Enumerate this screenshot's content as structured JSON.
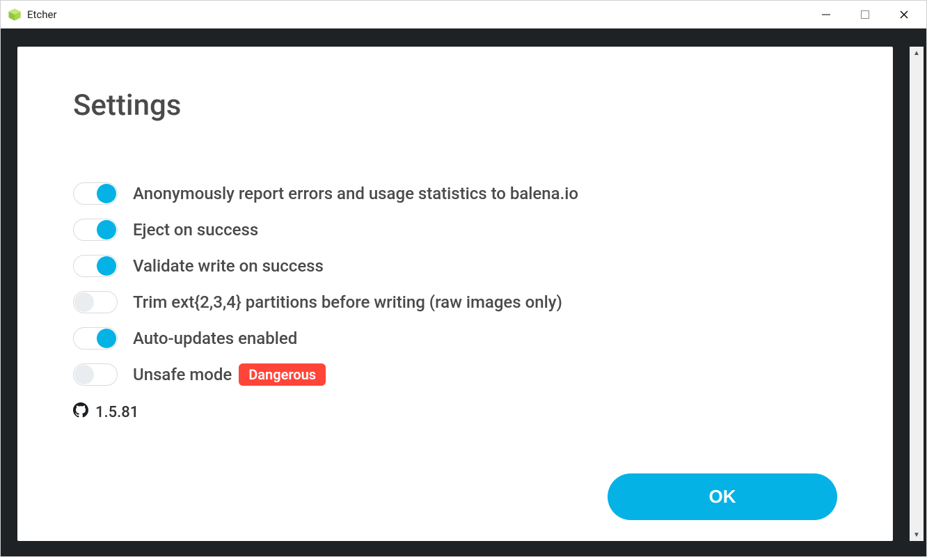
{
  "window": {
    "title": "Etcher"
  },
  "settings": {
    "title": "Settings",
    "items": [
      {
        "label": "Anonymously report errors and usage statistics to balena.io",
        "on": true
      },
      {
        "label": "Eject on success",
        "on": true
      },
      {
        "label": "Validate write on success",
        "on": true
      },
      {
        "label": "Trim ext{2,3,4} partitions before writing (raw images only)",
        "on": false
      },
      {
        "label": "Auto-updates enabled",
        "on": true
      },
      {
        "label": "Unsafe mode",
        "on": false,
        "badge": "Dangerous"
      }
    ],
    "version": "1.5.81",
    "ok_label": "OK"
  }
}
